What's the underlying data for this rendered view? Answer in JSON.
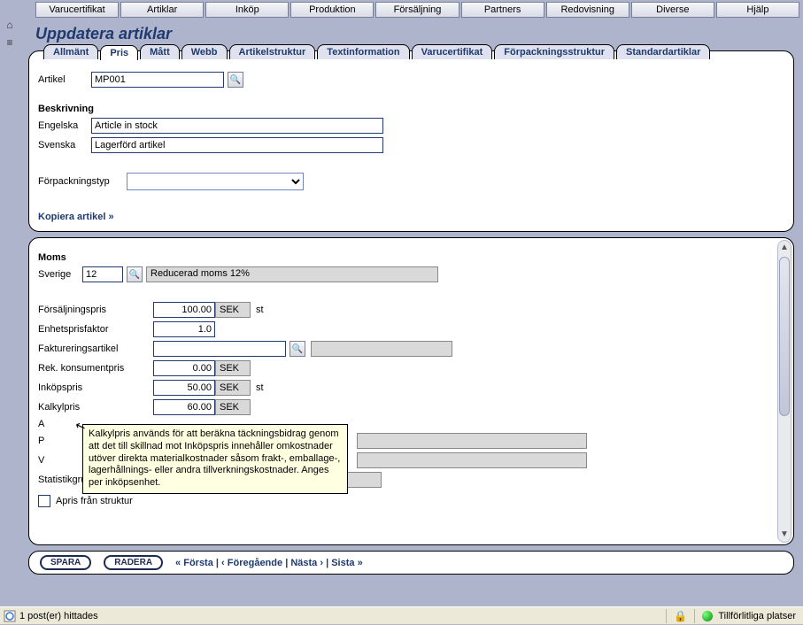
{
  "topmenu": [
    "Varucertifikat",
    "Artiklar",
    "Inköp",
    "Produktion",
    "Försäljning",
    "Partners",
    "Redovisning",
    "Diverse",
    "Hjälp"
  ],
  "page_title": "Uppdatera artiklar",
  "tabs": [
    "Allmänt",
    "Pris",
    "Mått",
    "Webb",
    "Artikelstruktur",
    "Textinformation",
    "Varucertifikat",
    "Förpackningsstruktur",
    "Standardartiklar"
  ],
  "active_tab": "Pris",
  "upper": {
    "artikel_label": "Artikel",
    "artikel_value": "MP001",
    "beskrivning_title": "Beskrivning",
    "engelska_label": "Engelska",
    "engelska_value": "Article in stock",
    "svenska_label": "Svenska",
    "svenska_value": "Lagerförd artikel",
    "forpackningstyp_label": "Förpackningstyp",
    "kopiera_link": "Kopiera artikel »"
  },
  "lower": {
    "moms_title": "Moms",
    "sverige_label": "Sverige",
    "sverige_value": "12",
    "sverige_desc": "Reducerad moms 12%",
    "rows": {
      "forsaljningspris": {
        "label": "Försäljningspris",
        "value": "100.00",
        "currency": "SEK",
        "unit": "st"
      },
      "enhetsprisfaktor": {
        "label": "Enhetsprisfaktor",
        "value": "1.0"
      },
      "faktureringsartikel": {
        "label": "Faktureringsartikel",
        "value": ""
      },
      "rek_konsumentpris": {
        "label": "Rek. konsumentpris",
        "value": "0.00",
        "currency": "SEK"
      },
      "inkopspris": {
        "label": "Inköpspris",
        "value": "50.00",
        "currency": "SEK",
        "unit": "st"
      },
      "kalkylpris": {
        "label": "Kalkylpris",
        "value": "60.00",
        "currency": "SEK"
      },
      "statistikgrupp": {
        "label": "Statistikgrupp",
        "value": ""
      }
    },
    "partial_labels": {
      "a": "A",
      "p": "P",
      "v": "V"
    },
    "tooltip": "Kalkylpris används för att beräkna täckningsbidrag genom att det till skillnad mot Inköpspris innehåller omkostnader utöver direkta materialkostnader såsom frakt-, emballage-, lagerhållnings- eller andra tillverkningskostnader. Anges per inköpsenhet.",
    "apris_label": "Apris från struktur"
  },
  "footer": {
    "spara": "SPARA",
    "radera": "RADERA",
    "nav": {
      "forsta": "« Första",
      "foregaende": "‹ Föregående",
      "nasta": "Nästa ›",
      "sista": "Sista »",
      "sep": " | "
    }
  },
  "statusbar": {
    "left": "1 post(er) hittades",
    "zone": "Tillförlitliga platser"
  }
}
